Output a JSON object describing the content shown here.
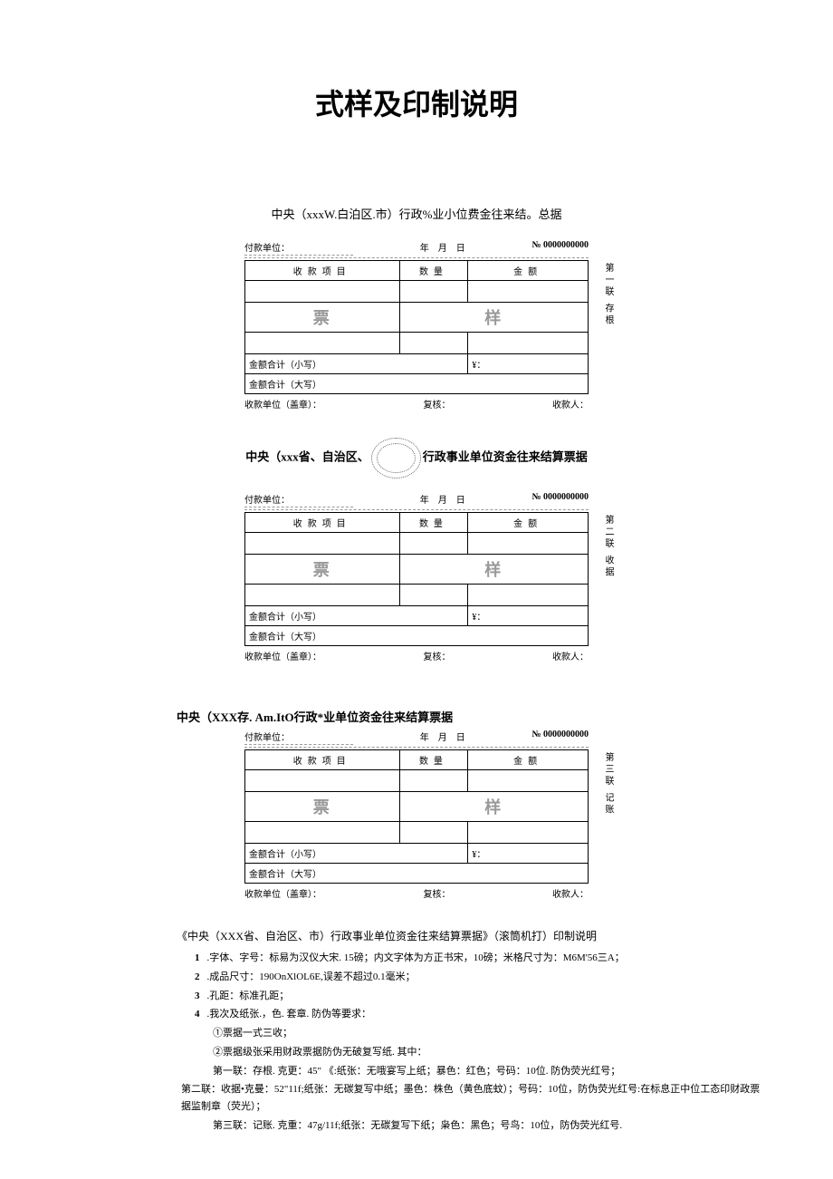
{
  "mainTitle": "式样及印制说明",
  "voucher1": {
    "title": "中央（xxxW.白泊区.市）行政%业小位费金往来结。总据",
    "payerLabel": "付款单位：",
    "dateLabel": "年　月　日",
    "noLabel": "№ 0000000000",
    "colItem": "收款项目",
    "colQty": "数量",
    "colAmt": "金额",
    "watermark1": "票",
    "watermark2": "样",
    "sumSmall": "金额合计（小写）",
    "sumBig": "金额合计（大写）",
    "yen": "¥：",
    "footerLeft": "收款单位（盖章）：",
    "footerMid": "复核：",
    "footerRight": "收款人：",
    "sideLabel": "第一联 存根"
  },
  "voucher2": {
    "title1": "中央（xxx省、自治区、",
    "title2": "行政事业单位资金往来结算票据",
    "payerLabel": "付款单位：",
    "dateLabel": "年　月　日",
    "noLabel": "№ 0000000000",
    "colItem": "收款项目",
    "colQty": "数量",
    "colAmt": "金额",
    "watermark1": "票",
    "watermark2": "样",
    "sumSmall": "金额合计（小写）",
    "sumBig": "金额合计（大写）",
    "yen": "¥：",
    "footerLeft": "收款单位（盖章）：",
    "footerMid": "复核：",
    "footerRight": "收款人：",
    "sideLabel": "第二联 收据"
  },
  "voucher3": {
    "title": "中央（XXX存. Am.ItO行政*业单位资金往来结算票据",
    "payerLabel": "付款单位：",
    "dateLabel": "年　月　日",
    "noLabel": "№ 0000000000",
    "colItem": "收款项目",
    "colQty": "数量",
    "colAmt": "金额",
    "watermark1": "票",
    "watermark2": "样",
    "sumSmall": "金额合计（小写）",
    "sumBig": "金额合计（大写）",
    "yen": "¥：",
    "footerLeft": "收款单位（盖章）：",
    "footerMid": "复核：",
    "footerRight": "收款人：",
    "sideLabel": "第三联 记账"
  },
  "instructions": {
    "title": "《中央（XXX省、自治区、市）行政事业单位资金往来结算票据》（滚筒机打）印制说明",
    "item1": ".字体、字号：标易为汉仪大宋. 15磅；内文字体为方正书宋，10磅；米格尺寸为：M6M'56三A；",
    "item2": ".成品尺寸：190OnXlOL6E,误差不超过0.1毫米；",
    "item3": ".孔距：标准孔距；",
    "item4": ".我次及纸张.，色. 套章. 防伪等要求：",
    "sub1": "①票据一式三收；",
    "sub2": "②票据级张采用财政票据防伪无破复写纸. 其中：",
    "sub3": "第一联：存根. 克更：45\" 《:纸张：无哦宴写上纸；暴色：红色；号码：10位. 防伪荧光红号；",
    "sub4": "第二联：收据•克曼：52\"11f;纸张：无碳复写中纸；墨色：株色（黄色底蚊）；号码：10位，防伪荧光红号:在标息正中位工态印财政票据监制章（荧光）；",
    "sub5": "第三联：记账. 克重：47g/11f;纸张：无碳复写下纸；枭色：黑色；号鸟：10位，防伪荧光红号."
  }
}
